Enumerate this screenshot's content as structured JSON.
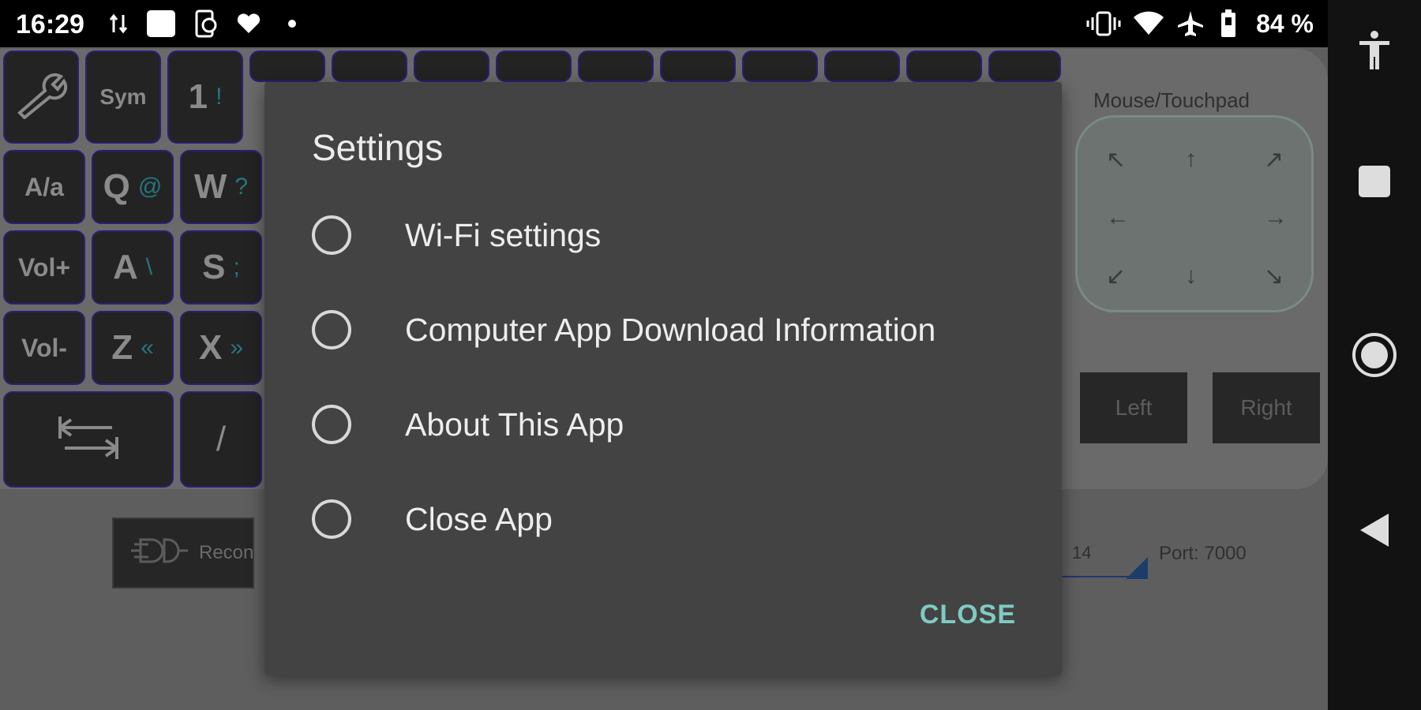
{
  "status_bar": {
    "time": "16:29",
    "battery_percent": "84 %",
    "icons": [
      "data-transfer-icon",
      "square-notification-icon",
      "screen-rotate-icon",
      "heart-icon",
      "dot-icon",
      "vibrate-icon",
      "wifi-icon",
      "airplane-icon",
      "battery-icon"
    ]
  },
  "navigation_bar": {
    "icons": [
      "accessibility-icon",
      "recents-icon",
      "home-icon",
      "back-icon"
    ]
  },
  "keyboard": {
    "keys": [
      {
        "name": "key-settings",
        "icon": "wrench-icon"
      },
      {
        "name": "key-sym",
        "label": "Sym"
      },
      {
        "name": "key-1",
        "label": "1",
        "alt": "!"
      },
      {
        "name": "key-aa",
        "label": "A/a"
      },
      {
        "name": "key-q",
        "label": "Q",
        "alt": "@"
      },
      {
        "name": "key-w",
        "label": "W",
        "alt": "?"
      },
      {
        "name": "key-volup",
        "label": "Vol+"
      },
      {
        "name": "key-a",
        "label": "A",
        "alt": "\\"
      },
      {
        "name": "key-s",
        "label": "S",
        "alt": ";"
      },
      {
        "name": "key-voldown",
        "label": "Vol-"
      },
      {
        "name": "key-z",
        "label": "Z",
        "alt": "«"
      },
      {
        "name": "key-x",
        "label": "X",
        "alt": "»"
      },
      {
        "name": "key-tab",
        "icon": "tab-icon"
      },
      {
        "name": "key-slash",
        "label": "/"
      }
    ]
  },
  "mouse": {
    "title": "Mouse/Touchpad",
    "arrows": [
      "↖",
      "↑",
      "↗",
      "←",
      "→",
      "↙",
      "↓",
      "↘"
    ],
    "left_label": "Left",
    "right_label": "Right"
  },
  "connection": {
    "reconnect_label": "Reconn",
    "ip_fragment": "14",
    "port_label": "Port: 7000"
  },
  "dialog": {
    "title": "Settings",
    "options": [
      {
        "label": "Wi-Fi settings",
        "selected": false
      },
      {
        "label": "Computer App Download Information",
        "selected": false
      },
      {
        "label": "About This App",
        "selected": false
      },
      {
        "label": "Close App",
        "selected": false
      }
    ],
    "close_label": "CLOSE"
  },
  "colors": {
    "accent": "#7fcbc2",
    "key_border": "#2d1e78",
    "dialog_bg": "#434343"
  }
}
